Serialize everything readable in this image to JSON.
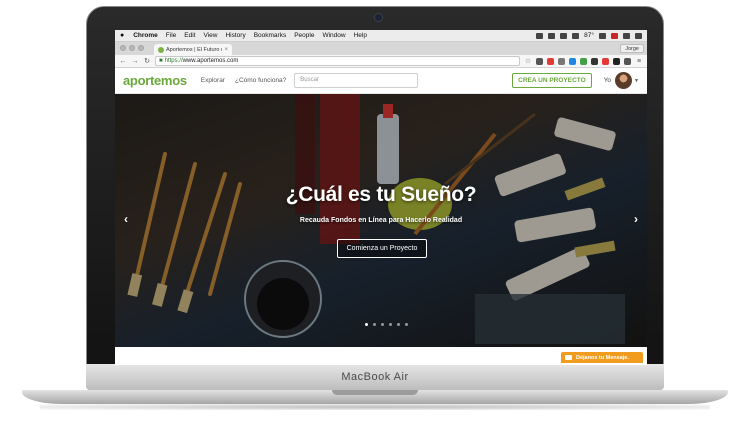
{
  "device": {
    "label": "MacBook Air"
  },
  "os_menubar": {
    "apple": "",
    "items": [
      "Chrome",
      "File",
      "Edit",
      "View",
      "History",
      "Bookmarks",
      "People",
      "Window",
      "Help"
    ],
    "battery": "87°"
  },
  "browser": {
    "tab_title": "Aportemos | El Futuro de",
    "profile": "Jorge",
    "url_protocol": "https://",
    "url_host": "www.aportemos.com"
  },
  "site": {
    "logo": "aportemos",
    "nav": {
      "explore": "Explorar",
      "how": "¿Cómo funciona?"
    },
    "search_placeholder": "Buscar",
    "cta": "CREA UN PROYECTO",
    "user": "Yo"
  },
  "hero": {
    "title": "¿Cuál es tu Sueño?",
    "subtitle": "Recauda Fondos en Línea para Hacerlo Realidad",
    "button": "Comienza un Proyecto"
  },
  "feedback": {
    "label": "Déjanos tu Mensaje."
  },
  "colors": {
    "brand_green": "#6aa83a",
    "feedback_orange": "#f29c1f"
  }
}
